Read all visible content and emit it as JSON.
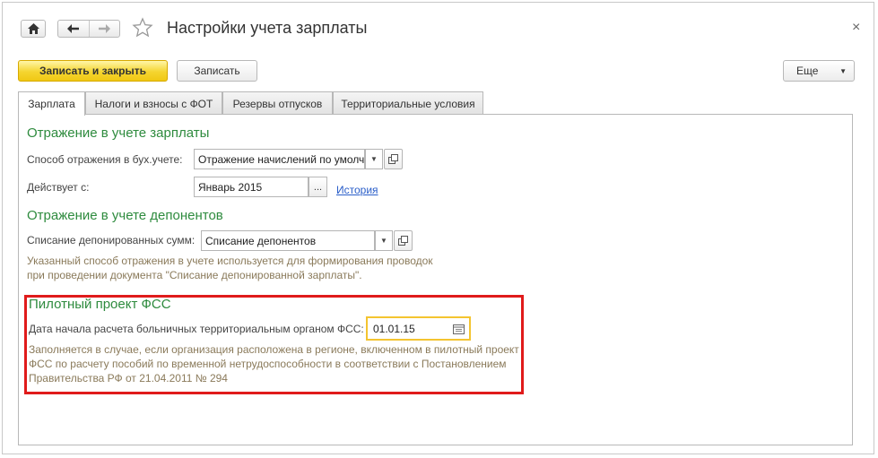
{
  "window": {
    "title": "Настройки учета зарплаты",
    "close_glyph": "×"
  },
  "icons": {
    "home": "home-icon",
    "back": "arrow-left-icon",
    "forward": "arrow-right-icon",
    "favorite": "star-icon",
    "close": "close-icon"
  },
  "toolbar": {
    "save_close_label": "Записать и закрыть",
    "save_label": "Записать",
    "more_label": "Еще",
    "more_arrow": "▼"
  },
  "tabs": [
    {
      "label": "Зарплата",
      "active": true
    },
    {
      "label": "Налоги и взносы с ФОТ",
      "active": false
    },
    {
      "label": "Резервы отпусков",
      "active": false
    },
    {
      "label": "Территориальные условия",
      "active": false
    }
  ],
  "salary_section": {
    "title": "Отражение в учете зарплаты",
    "method_label": "Способ отражения в бух.учете:",
    "method_value": "Отражение начислений по умолч",
    "effective_label": "Действует с:",
    "effective_value": "Январь 2015",
    "effective_button": "...",
    "history_link": "История"
  },
  "deponent_section": {
    "title": "Отражение в учете депонентов",
    "writeoff_label": "Списание депонированных сумм:",
    "writeoff_value": "Списание депонентов",
    "note_line1": "Указанный способ отражения в учете используется для формирования проводок",
    "note_line2": "при проведении документа \"Списание депонированной зарплаты\"."
  },
  "fss_section": {
    "title": "Пилотный проект ФСС",
    "date_label": "Дата начала расчета больничных территориальным органом ФСС:",
    "date_value": "01.01.15",
    "note_line1": "Заполняется в случае, если организация расположена в регионе, включенном в пилотный проект",
    "note_line2": "ФСС по расчету пособий по временной нетрудоспособности в соответствии с Постановлением",
    "note_line3": "Правительства РФ от 21.04.2011 № 294"
  },
  "dropdown_arrow": "▼",
  "colors": {
    "section_title": "#2e8b3e",
    "primary_button": "#f5d530",
    "highlight_box": "#e01b1b",
    "link": "#2a5ec9",
    "note_text": "#8a7a5a",
    "date_field_border": "#f4c430"
  }
}
